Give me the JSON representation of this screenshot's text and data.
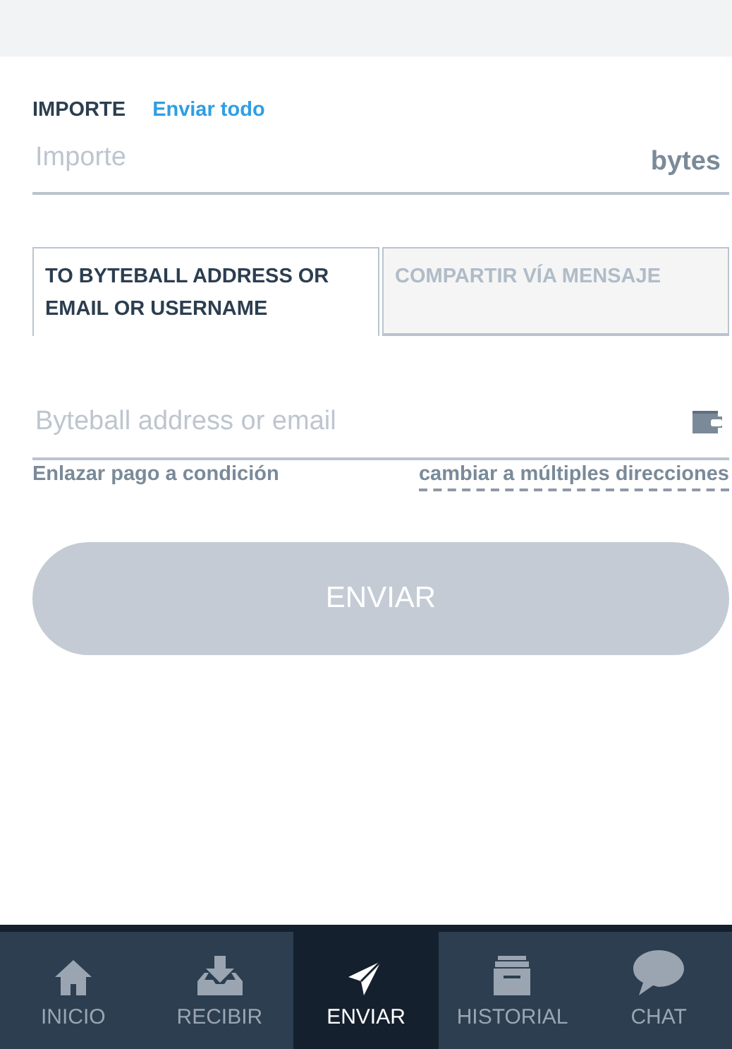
{
  "amount": {
    "label": "IMPORTE",
    "send_all": "Enviar todo",
    "placeholder": "Importe",
    "unit": "bytes"
  },
  "recipient_tabs": [
    {
      "label": "TO BYTEBALL ADDRESS OR EMAIL OR USERNAME",
      "selected": true
    },
    {
      "label": "COMPARTIR VÍA MENSAJE",
      "selected": false
    }
  ],
  "address": {
    "placeholder": "Byteball address or email"
  },
  "links": {
    "conditional_payment": "Enlazar pago a condición",
    "multiple_addresses": "cambiar a múltiples direcciones"
  },
  "send_button": {
    "label": "ENVIAR",
    "disabled": true
  },
  "bottom_nav": [
    {
      "kind": "home",
      "label": "INICIO",
      "selected": false
    },
    {
      "kind": "receive",
      "label": "RECIBIR",
      "selected": false
    },
    {
      "kind": "send",
      "label": "ENVIAR",
      "selected": true
    },
    {
      "kind": "history",
      "label": "HISTORIAL",
      "selected": false
    },
    {
      "kind": "chat",
      "label": "CHAT",
      "selected": false
    }
  ]
}
